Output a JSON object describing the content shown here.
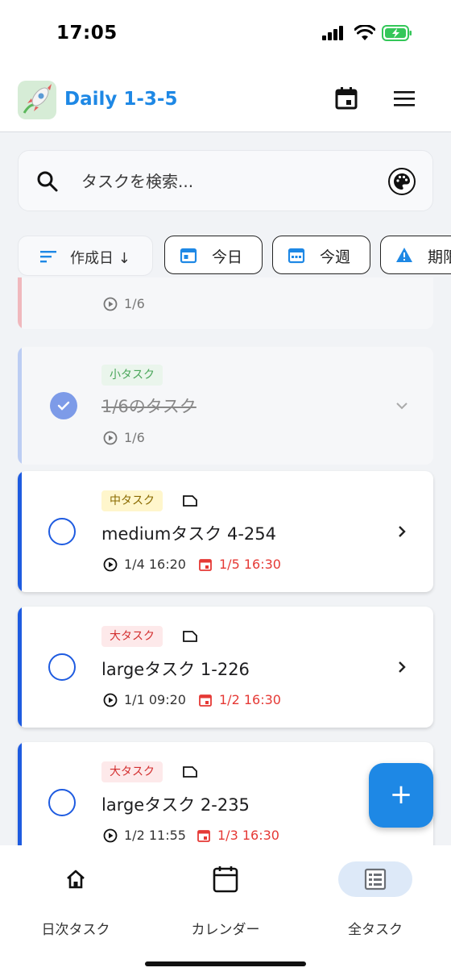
{
  "status": {
    "time": "17:05"
  },
  "header": {
    "title": "Daily 1-3-5"
  },
  "search": {
    "placeholder": "タスクを検索..."
  },
  "filters": {
    "sort_label": "作成日 ↓",
    "chips": [
      "今日",
      "今週",
      "期限"
    ]
  },
  "tasks": [
    {
      "start": "1/6"
    },
    {
      "size": "小タスク",
      "title": "1/6のタスク",
      "start": "1/6",
      "done": true
    },
    {
      "size": "中タスク",
      "title": "mediumタスク 4-254",
      "start": "1/4 16:20",
      "due": "1/5 16:30"
    },
    {
      "size": "大タスク",
      "title": "largeタスク 1-226",
      "start": "1/1 09:20",
      "due": "1/2 16:30"
    },
    {
      "size": "大タスク",
      "title": "largeタスク 2-235",
      "start": "1/2 11:55",
      "due": "1/3 16:30"
    }
  ],
  "fab": {
    "label": "+"
  },
  "nav": [
    {
      "label": "日次タスク",
      "icon": "home-icon"
    },
    {
      "label": "カレンダー",
      "icon": "calendar-icon"
    },
    {
      "label": "全タスク",
      "icon": "list-icon",
      "active": true
    }
  ],
  "colors": {
    "accent": "#1e88e5",
    "due": "#e53935",
    "task_bar": "#1e5be0"
  }
}
